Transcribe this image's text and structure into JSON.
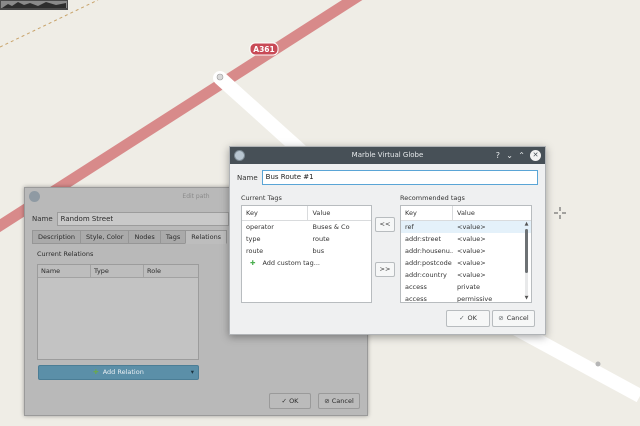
{
  "map": {
    "road_label": "A361",
    "colors": {
      "background": "#efede6",
      "trunk_road": "#d88a8a",
      "minor_road": "#ffffff",
      "footpath": "#c8a36a"
    }
  },
  "back_dialog": {
    "title": "Edit path",
    "name_label": "Name",
    "name_value": "Random Street",
    "tabs": [
      "Description",
      "Style, Color",
      "Nodes",
      "Tags",
      "Relations"
    ],
    "section_label": "Current Relations",
    "columns": [
      "Name",
      "Type",
      "Role"
    ],
    "add_relation_label": "Add Relation",
    "ok_label": "OK",
    "cancel_label": "Cancel"
  },
  "dialog": {
    "title": "Marble Virtual Globe",
    "name_label": "Name",
    "name_value": "Bus Route #1",
    "current_tags": {
      "label": "Current Tags",
      "columns": [
        "Key",
        "Value"
      ],
      "rows": [
        {
          "key": "operator",
          "value": "Buses & Co"
        },
        {
          "key": "type",
          "value": "route"
        },
        {
          "key": "route",
          "value": "bus"
        }
      ],
      "add_custom_label": "Add custom tag..."
    },
    "move_left_label": "<<",
    "move_right_label": ">>",
    "recommended_tags": {
      "label": "Recommended tags",
      "columns": [
        "Key",
        "Value"
      ],
      "rows": [
        {
          "key": "ref",
          "value": "<value>"
        },
        {
          "key": "addr:street",
          "value": "<value>"
        },
        {
          "key": "addr:housenu...",
          "value": "<value>"
        },
        {
          "key": "addr:postcode",
          "value": "<value>"
        },
        {
          "key": "addr:country",
          "value": "<value>"
        },
        {
          "key": "access",
          "value": "private"
        },
        {
          "key": "access",
          "value": "permissive"
        }
      ]
    },
    "ok_label": "OK",
    "cancel_label": "Cancel"
  }
}
